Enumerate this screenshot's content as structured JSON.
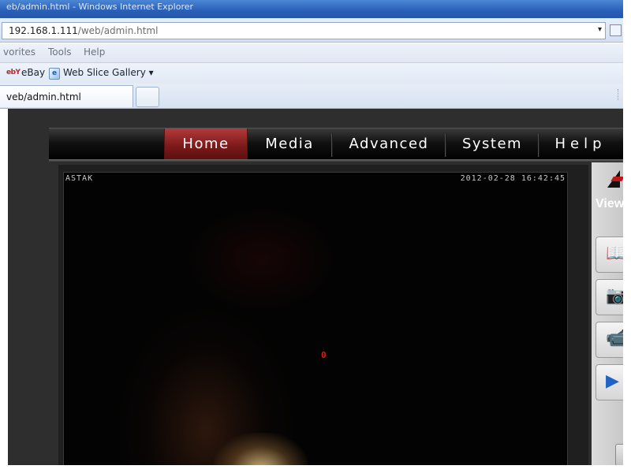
{
  "browser": {
    "window_title": "eb/admin.html - Windows Internet Explorer",
    "url_host": "192.168.1.111",
    "url_path": "/web/admin.html",
    "menu": [
      "vorites",
      "Tools",
      "Help"
    ],
    "favorites": {
      "ebay_logo": "ebY",
      "ebay_label": "eBay",
      "web_slice_label": "Web Slice Gallery ▾",
      "web_slice_icon_glyph": "e"
    },
    "tab_label": "veb/admin.html",
    "url_dropdown_glyph": "▾"
  },
  "page": {
    "nav": [
      "Home",
      "Media",
      "Advanced",
      "System",
      "Help"
    ],
    "active_nav": "Home",
    "video": {
      "camera_name": "ASTAK",
      "timestamp": "2012-02-28 16:42:45",
      "center_marker": "0"
    },
    "side_panel": {
      "heading": "View",
      "buttons": [
        {
          "icon": "book-icon",
          "glyph": "📖"
        },
        {
          "icon": "camera-icon",
          "glyph": "📷"
        },
        {
          "icon": "video-camera-icon",
          "glyph": "📹"
        },
        {
          "icon": "play-icon",
          "glyph": "▶"
        }
      ]
    }
  },
  "colors": {
    "active_nav": "#8a1e1e",
    "osd_text": "#c8c8c8",
    "center_marker": "#e01818",
    "page_bg": "#2e2e2e"
  }
}
